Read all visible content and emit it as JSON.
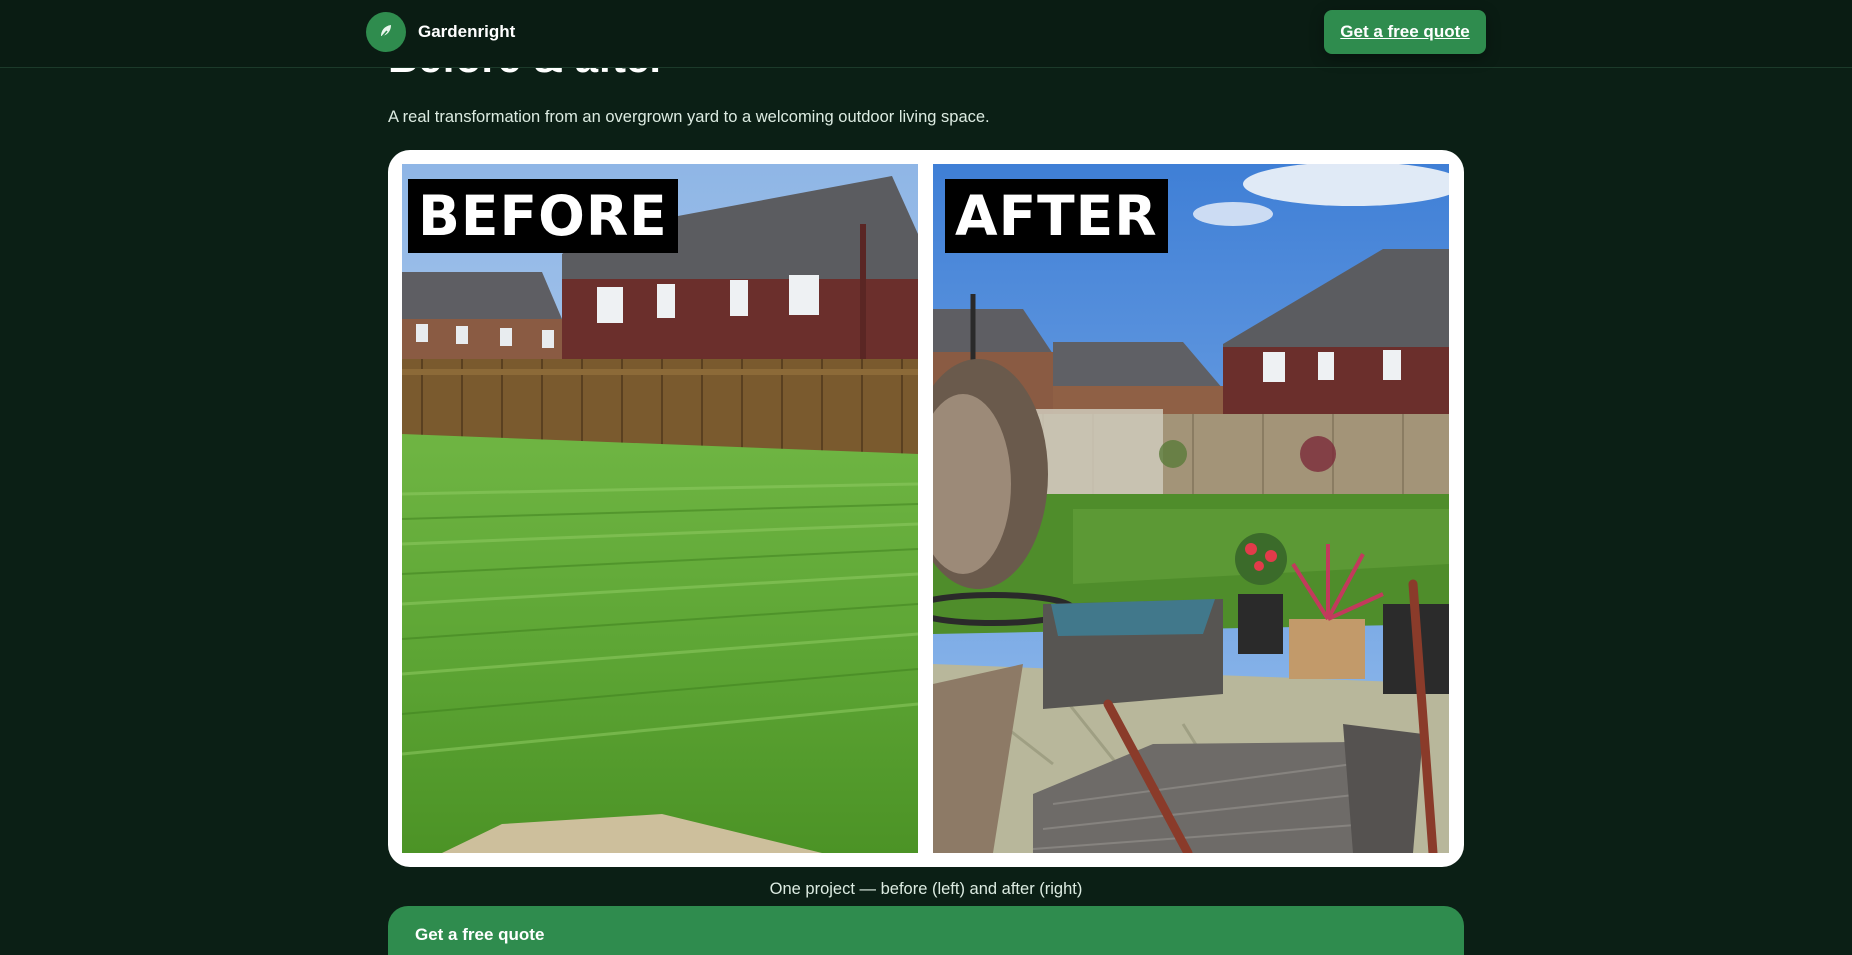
{
  "header": {
    "brand_name": "Gardenright",
    "logo_icon": "leaf-icon",
    "cta_label": "Get a free quote"
  },
  "section": {
    "heading": "Before & after",
    "subtitle": "A real transformation from an overgrown yard to a welcoming outdoor living space.",
    "before_label": "BEFORE",
    "after_label": "AFTER",
    "caption": "One project — before (left) and after (right)"
  },
  "bottom_cta": {
    "label": "Get a free quote"
  },
  "colors": {
    "background": "#0b1f15",
    "header_bg": "#0a1c13",
    "accent": "#2f8c4e",
    "text": "#dcebe1"
  }
}
